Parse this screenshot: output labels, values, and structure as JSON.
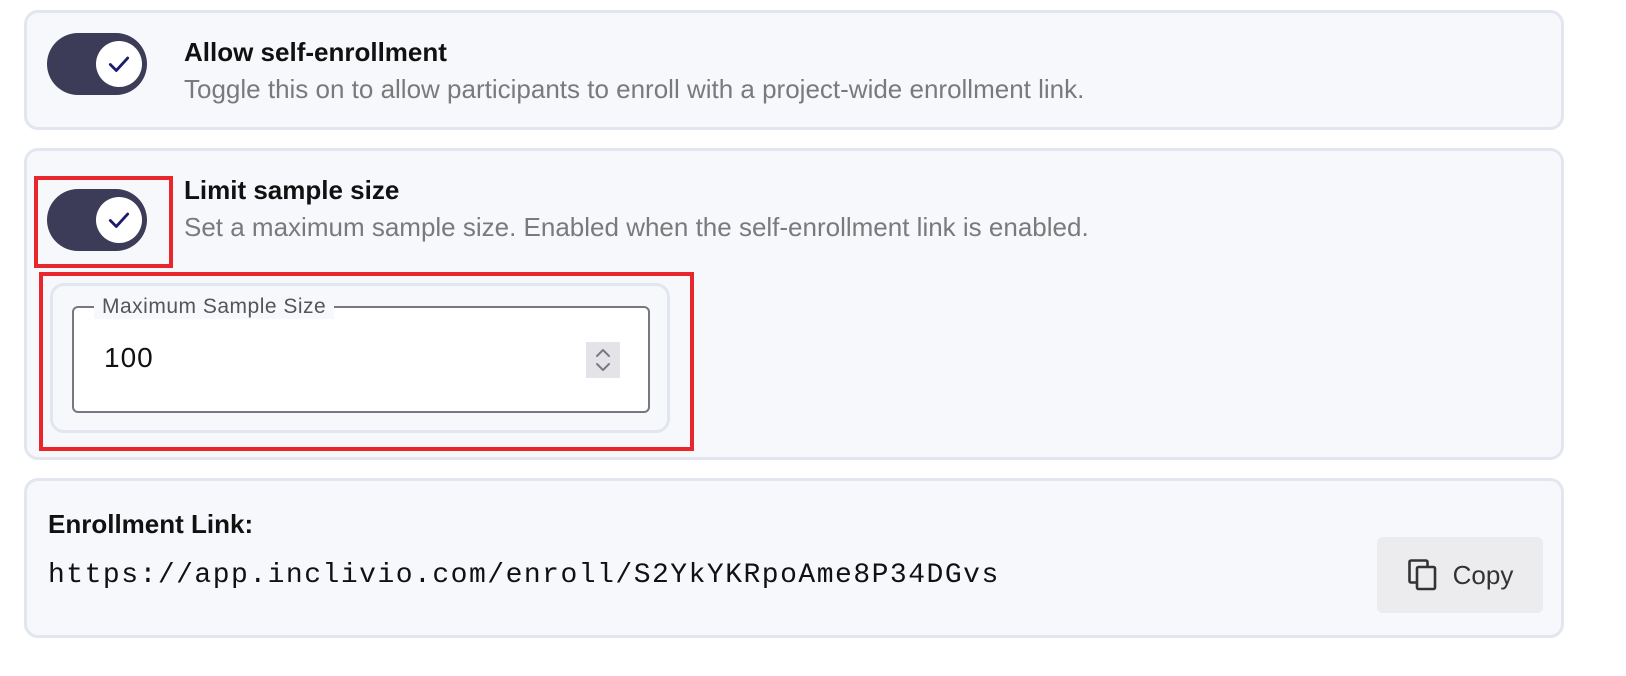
{
  "self_enrollment": {
    "enabled": true,
    "title": "Allow self-enrollment",
    "description": "Toggle this on to allow participants to enroll with a project-wide enrollment link."
  },
  "limit_sample": {
    "enabled": true,
    "title": "Limit sample size",
    "description": "Set a maximum sample size. Enabled when the self-enrollment link is enabled.",
    "field": {
      "label": "Maximum Sample Size",
      "value": "100"
    }
  },
  "enrollment_link": {
    "title": "Enrollment Link:",
    "url": "https://app.inclivio.com/enroll/S2YkYKRpoAme8P34DGvs",
    "copy_label": "Copy"
  },
  "colors": {
    "toggle_on": "#3d3c58",
    "card_bg": "#f7f8fc",
    "card_border": "#e2e6ef",
    "highlight": "#e8262b",
    "muted_text": "#7a7a7a"
  },
  "icons": {
    "toggle_check": "check-icon",
    "stepper": "chevron-up-down-icon",
    "copy": "copy-icon"
  }
}
